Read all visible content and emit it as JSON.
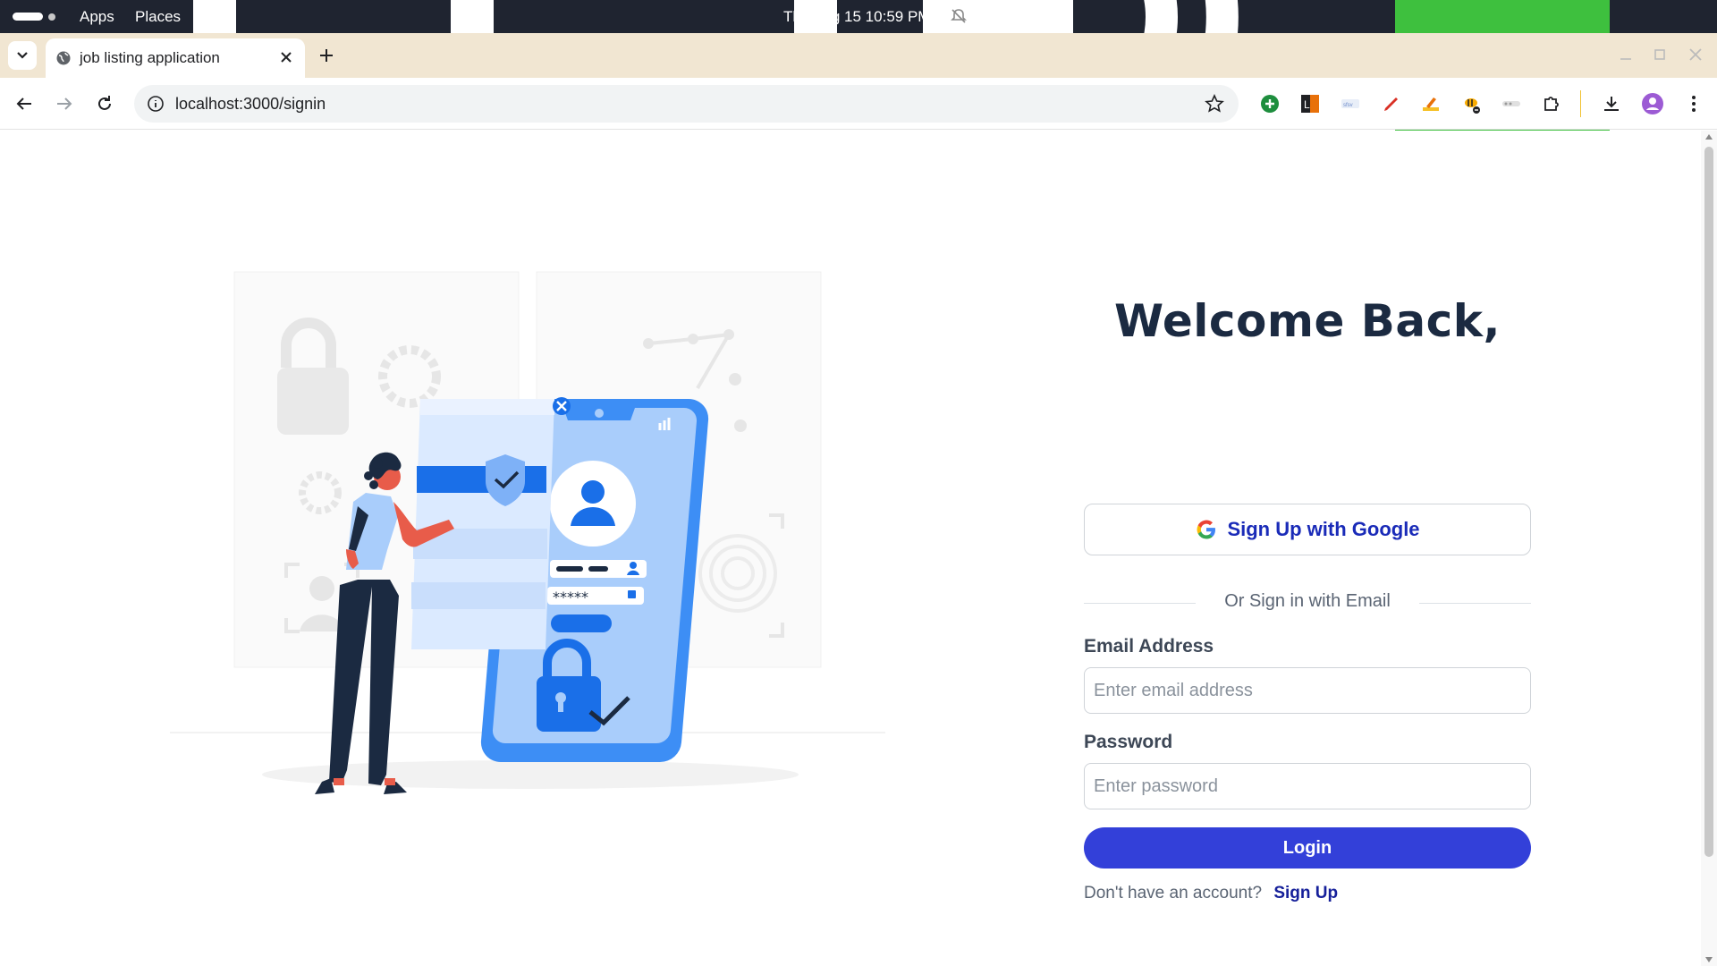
{
  "system": {
    "apps_label": "Apps",
    "places_label": "Places",
    "clock": "Thu Aug 15  10:59 PM"
  },
  "browser": {
    "tab_title": "job listing application",
    "url": "localhost:3000/signin",
    "extensions": [
      "add-icon",
      "lh-extension-icon",
      "sfsv-extension-icon",
      "pen-extension-icon",
      "highlighter-extension-icon",
      "bee-extension-icon",
      "gray-extension-icon",
      "puzzle-icon",
      "download-icon",
      "profile-avatar",
      "menu-icon"
    ]
  },
  "page": {
    "heading": "Welcome Back,",
    "google_button": "Sign Up with Google",
    "divider_text": "Or Sign in with Email",
    "email_label": "Email Address",
    "email_placeholder": "Enter email address",
    "password_label": "Password",
    "password_placeholder": "Enter password",
    "login_button": "Login",
    "no_account_text": "Don't have an account?",
    "signup_link": "Sign Up"
  },
  "colors": {
    "accent": "#3340d9",
    "heading": "#1b2a41",
    "link": "#16209a",
    "illustration_blue": "#3d8ef5"
  }
}
